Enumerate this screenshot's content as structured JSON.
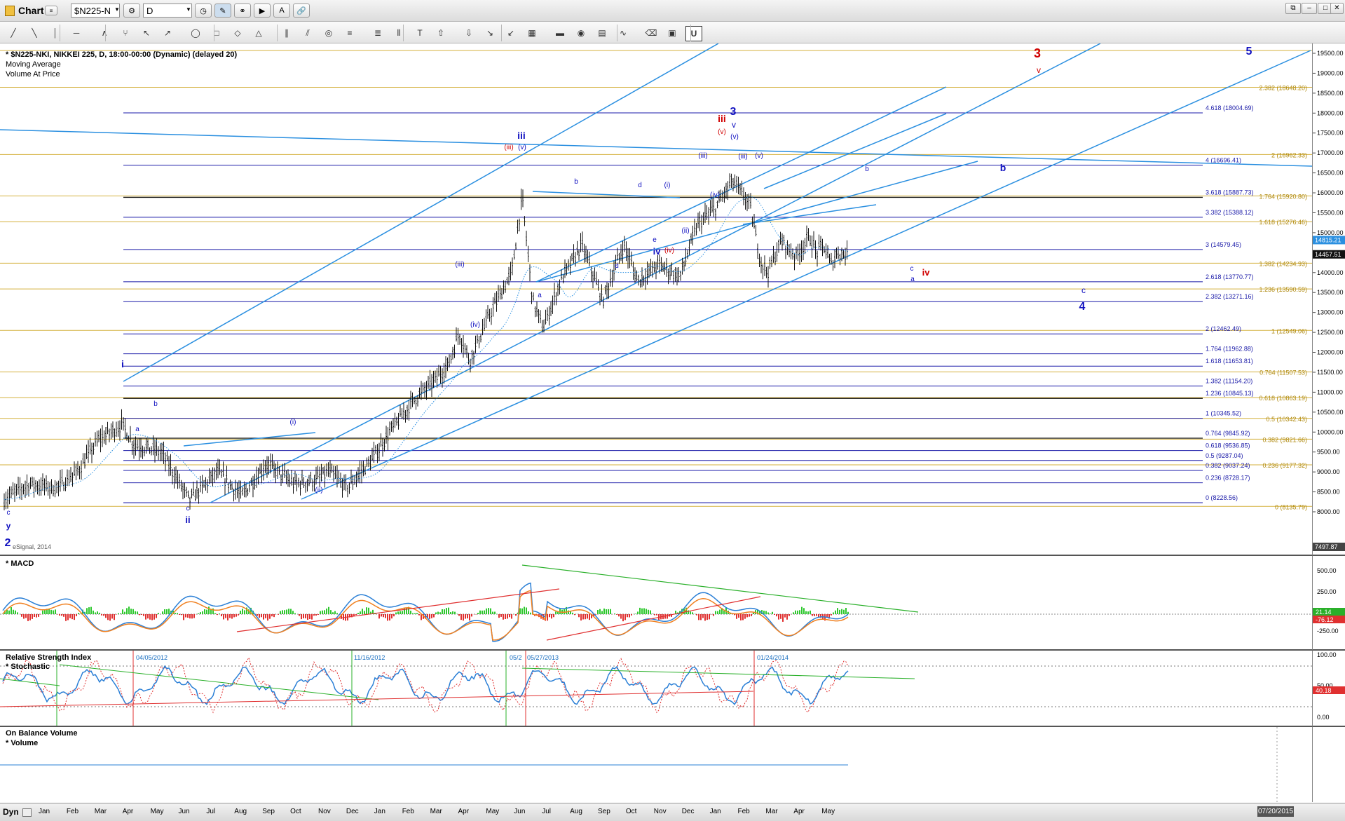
{
  "app": {
    "title": "Chart",
    "symbol_input": "$N225-N",
    "interval_input": "D",
    "window_buttons": [
      "⧉",
      "–",
      "□",
      "✕"
    ],
    "dyn_label": "Dyn"
  },
  "toolbar_icons": [
    "line-tool-icon",
    "ray-tool-icon",
    "vertical-line-icon",
    "horizontal-line-icon",
    "wave-tool-icon",
    "pitchfork-icon",
    "fan-icon",
    "gann-icon",
    "ellipse-icon",
    "rectangle-icon",
    "polygon-icon",
    "triangle-icon",
    "parallel-lines-icon",
    "channel-icon",
    "cycle-icon",
    "fib-retracement-icon",
    "fib-extension-icon",
    "fib-time-icon",
    "text-icon",
    "arrow-up-icon",
    "arrow-down-icon",
    "andrews-icon",
    "speed-lines-icon",
    "grid-icon",
    "mob-icon",
    "eye-icon",
    "pti-icon",
    "zigzag-icon",
    "eraser-icon",
    "comment-icon",
    "u-tool-icon"
  ],
  "main_pane": {
    "title": "* $N225-NKI, NIKKEI 225, D, 18:00-00:00 (Dynamic) (delayed 20)",
    "studies": [
      "Moving Average",
      "Volume At Price"
    ],
    "watermark": "eSignal, 2014",
    "y_ticks": [
      "19500.00",
      "19000.00",
      "18500.00",
      "18000.00",
      "17500.00",
      "17000.00",
      "16500.00",
      "16000.00",
      "15500.00",
      "15000.00",
      "14500.00",
      "14000.00",
      "13500.00",
      "13000.00",
      "12500.00",
      "12000.00",
      "11500.00",
      "11000.00",
      "10500.00",
      "10000.00",
      "9500.00",
      "9000.00",
      "8500.00",
      "8000.00"
    ],
    "price_tags": [
      "14815.21",
      "14457.51",
      "7497.87"
    ],
    "blue_fibs": [
      {
        "label": "4.618 (18004.69)",
        "value": 18004.69
      },
      {
        "label": "4 (16696.41)",
        "value": 16696.41
      },
      {
        "label": "3.618 (15887.73)",
        "value": 15887.73
      },
      {
        "label": "3.382 (15388.12)",
        "value": 15388.12
      },
      {
        "label": "3 (14579.45)",
        "value": 14579.45
      },
      {
        "label": "2.618 (13770.77)",
        "value": 13770.77
      },
      {
        "label": "2.382 (13271.16)",
        "value": 13271.16
      },
      {
        "label": "2 (12462.49)",
        "value": 12462.49
      },
      {
        "label": "1.764 (11962.88)",
        "value": 11962.88
      },
      {
        "label": "1.618 (11653.81)",
        "value": 11653.81
      },
      {
        "label": "1.382 (11154.20)",
        "value": 11154.2
      },
      {
        "label": "1.236 (10845.13)",
        "value": 10845.13
      },
      {
        "label": "1 (10345.52)",
        "value": 10345.52
      },
      {
        "label": "0.764 (9845.92)",
        "value": 9845.92
      },
      {
        "label": "0.618 (9536.85)",
        "value": 9536.85
      },
      {
        "label": "0.5 (9287.04)",
        "value": 9287.04
      },
      {
        "label": "0.382 (9037.24)",
        "value": 9037.24
      },
      {
        "label": "0.236 (8728.17)",
        "value": 8728.17
      },
      {
        "label": "0 (8228.56)",
        "value": 8228.56
      }
    ],
    "gold_fibs": [
      {
        "label": "2.382 (18648.20)",
        "value": 18648.2
      },
      {
        "label": "2 (16962.33)",
        "value": 16962.33
      },
      {
        "label": "1.764 (15920.80)",
        "value": 15920.8
      },
      {
        "label": "1.618 (15276.46)",
        "value": 15276.46
      },
      {
        "label": "1.382 (14234.93)",
        "value": 14234.93
      },
      {
        "label": "1.236 (13590.59)",
        "value": 13590.59
      },
      {
        "label": "1 (12549.06)",
        "value": 12549.06
      },
      {
        "label": "0.764 (11507.53)",
        "value": 11507.53
      },
      {
        "label": "0.618 (10863.19)",
        "value": 10863.19
      },
      {
        "label": "0.5 (10342.43)",
        "value": 10342.43
      },
      {
        "label": "0.382 (9821.66)",
        "value": 9821.66
      },
      {
        "label": "0.236 (9177.32)",
        "value": 9177.32
      },
      {
        "label": "0 (8135.79)",
        "value": 8135.79
      }
    ],
    "wave_labels": [
      {
        "t": "3",
        "c": "#d00000",
        "b": true
      },
      {
        "t": "v",
        "c": "#d00000",
        "b": false
      },
      {
        "t": "5",
        "c": "#1010c0",
        "b": true
      },
      {
        "t": "iii",
        "c": "#d00000",
        "b": true
      },
      {
        "t": "3",
        "c": "#1010c0",
        "b": true
      },
      {
        "t": "v",
        "c": "#1010c0",
        "b": false
      },
      {
        "t": "(v)",
        "c": "#d00000",
        "b": false
      },
      {
        "t": "(v)",
        "c": "#1010c0",
        "b": false
      },
      {
        "t": "iii",
        "c": "#1010c0",
        "b": true
      },
      {
        "t": "(iii)",
        "c": "#d00000",
        "b": false
      },
      {
        "t": "(v)",
        "c": "#1010c0",
        "b": false
      },
      {
        "t": "(iii)",
        "c": "#1010c0",
        "b": false
      },
      {
        "t": "(iv)",
        "c": "#1010c0",
        "b": false
      },
      {
        "t": "b",
        "c": "#1010c0",
        "b": false
      },
      {
        "t": "d",
        "c": "#1010c0",
        "b": false
      },
      {
        "t": "(i)",
        "c": "#1010c0",
        "b": false
      },
      {
        "t": "e",
        "c": "#1010c0",
        "b": false
      },
      {
        "t": "(ii)",
        "c": "#1010c0",
        "b": false
      },
      {
        "t": "iv",
        "c": "#1010c0",
        "b": true
      },
      {
        "t": "(iv)",
        "c": "#d00000",
        "b": false
      },
      {
        "t": "d",
        "c": "#1010c0",
        "b": false
      },
      {
        "t": "a",
        "c": "#1010c0",
        "b": false
      },
      {
        "t": "b",
        "c": "#1010c0",
        "b": false
      },
      {
        "t": "b",
        "c": "#1010c0",
        "b": true
      },
      {
        "t": "c",
        "c": "#1010c0",
        "b": false
      },
      {
        "t": "a",
        "c": "#1010c0",
        "b": false
      },
      {
        "t": "iv",
        "c": "#d00000",
        "b": true
      },
      {
        "t": "c",
        "c": "#1010c0",
        "b": false
      },
      {
        "t": "4",
        "c": "#1010c0",
        "b": true
      },
      {
        "t": "(iii)",
        "c": "#1010c0",
        "b": false
      },
      {
        "t": "(iv)",
        "c": "#1010c0",
        "b": false
      },
      {
        "t": "i",
        "c": "#1010c0",
        "b": true
      },
      {
        "t": "b",
        "c": "#1010c0",
        "b": false
      },
      {
        "t": "a",
        "c": "#1010c0",
        "b": false
      },
      {
        "t": "(i)",
        "c": "#1010c0",
        "b": false
      },
      {
        "t": "(ii)",
        "c": "#1010c0",
        "b": false
      },
      {
        "t": "c",
        "c": "#1010c0",
        "b": false
      },
      {
        "t": "ii",
        "c": "#1010c0",
        "b": true
      },
      {
        "t": "c",
        "c": "#1010c0",
        "b": false
      },
      {
        "t": "y",
        "c": "#1010c0",
        "b": true
      },
      {
        "t": "2",
        "c": "#1010c0",
        "b": true
      },
      {
        "t": "(iii)",
        "c": "#1010c0",
        "b": false
      },
      {
        "t": "(v)",
        "c": "#1010c0",
        "b": false
      }
    ]
  },
  "macd_pane": {
    "title": "* MACD",
    "y_ticks": [
      "500.00",
      "250.00",
      "-250.00"
    ],
    "value_tags": [
      "21.14",
      "-76.12"
    ]
  },
  "rsi_pane": {
    "title": "Relative Strength Index",
    "subtitle": "* Stochastic",
    "y_ticks": [
      "100.00",
      "50.00",
      "0.00"
    ],
    "value_tags": [
      "40.18"
    ],
    "date_markers": [
      "04/05/2012",
      "11/16/2012",
      "05/2",
      "05/27/2013",
      "01/24/2014"
    ]
  },
  "obv_pane": {
    "title": "On Balance Volume",
    "subtitle": "* Volume"
  },
  "x_axis": {
    "months": [
      "Jan",
      "Feb",
      "Mar",
      "Apr",
      "May",
      "Jun",
      "Jul",
      "Aug",
      "Sep",
      "Oct",
      "Nov",
      "Dec",
      "Jan",
      "Feb",
      "Mar",
      "Apr",
      "May",
      "Jun",
      "Jul",
      "Aug",
      "Sep",
      "Oct",
      "Nov",
      "Dec",
      "Jan",
      "Feb",
      "Mar",
      "Apr",
      "May"
    ],
    "cursor_date": "07/20/2015"
  },
  "colors": {
    "fib_blue": "#1a1aa8",
    "fib_gold": "#d4b03c",
    "trend_line": "#2a8fe0",
    "bars": "#111111",
    "macd_line": "#2a7fd6",
    "signal_line": "#f08020",
    "hist_pos": "#2ec82e",
    "hist_neg": "#e03030",
    "wave_red": "#d00000",
    "wave_blue": "#1010c0"
  }
}
